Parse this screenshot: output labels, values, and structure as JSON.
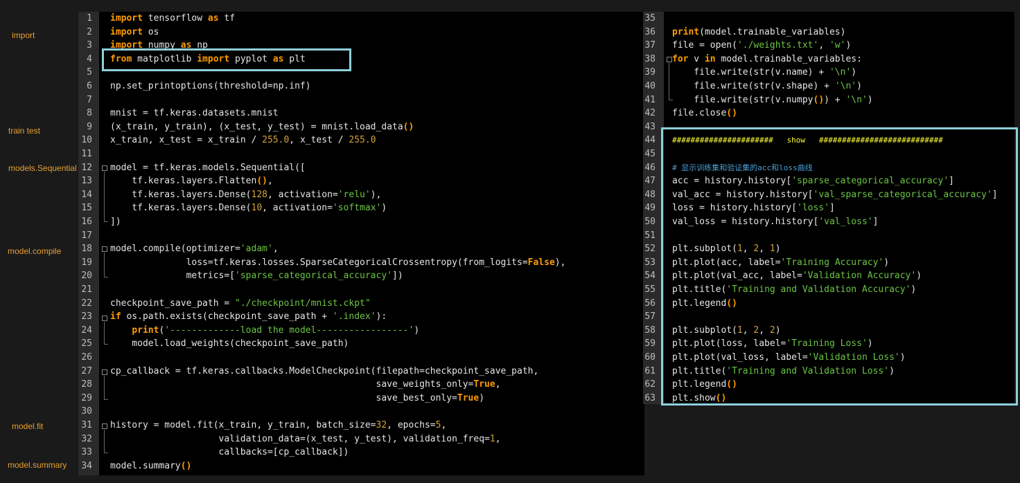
{
  "side_labels": [
    {
      "id": "import",
      "text": "import"
    },
    {
      "id": "train-test",
      "text": "train  test"
    },
    {
      "id": "models-sequential",
      "text": "models.Sequential"
    },
    {
      "id": "model-compile",
      "text": "model.compile"
    },
    {
      "id": "model-fit",
      "text": "model.fit"
    },
    {
      "id": "model-summary",
      "text": "model.summary"
    }
  ],
  "left_panel": {
    "lines": [
      {
        "n": "1",
        "code": "<span class='kw'>import</span> tensorflow <span class='kw'>as</span> tf"
      },
      {
        "n": "2",
        "code": "<span class='kw'>import</span> os"
      },
      {
        "n": "3",
        "code": "<span class='kw'>import</span> numpy <span class='kw'>as</span> np"
      },
      {
        "n": "4",
        "code": "<span class='kw'>from</span> matplotlib <span class='kw'>import</span> pyplot <span class='kw'>as</span> plt"
      },
      {
        "n": "5",
        "code": ""
      },
      {
        "n": "6",
        "code": "np.set_printoptions(threshold=np.inf)"
      },
      {
        "n": "7",
        "code": ""
      },
      {
        "n": "8",
        "code": "mnist = tf.keras.datasets.mnist"
      },
      {
        "n": "9",
        "code": "(x_train, y_train), (x_test, y_test) = mnist.load_data<span class='kw'>()</span>"
      },
      {
        "n": "10",
        "code": "x_train, x_test = x_train / <span class='nm'>255.0</span>, x_test / <span class='nm'>255.0</span>"
      },
      {
        "n": "11",
        "code": ""
      },
      {
        "n": "12",
        "code": "model = tf.keras.models.Sequential(["
      },
      {
        "n": "13",
        "code": "    tf.keras.layers.Flatten<span class='kw'>()</span>,"
      },
      {
        "n": "14",
        "code": "    tf.keras.layers.Dense(<span class='nm'>128</span>, activation=<span class='st'>'relu'</span>),"
      },
      {
        "n": "15",
        "code": "    tf.keras.layers.Dense(<span class='nm'>10</span>, activation=<span class='st'>'softmax'</span>)"
      },
      {
        "n": "16",
        "code": "])"
      },
      {
        "n": "17",
        "code": ""
      },
      {
        "n": "18",
        "code": "model.compile(optimizer=<span class='st'>'adam'</span>,"
      },
      {
        "n": "19",
        "code": "              loss=tf.keras.losses.SparseCategoricalCrossentropy(from_logits=<span class='kw'>False</span>),"
      },
      {
        "n": "20",
        "code": "              metrics=[<span class='st'>'sparse_categorical_accuracy'</span>])"
      },
      {
        "n": "21",
        "code": ""
      },
      {
        "n": "22",
        "code": "checkpoint_save_path = <span class='st'>\"./checkpoint/mnist.ckpt\"</span>"
      },
      {
        "n": "23",
        "code": "<span class='kw'>if</span> os.path.exists(checkpoint_save_path + <span class='st'>'.index'</span>):"
      },
      {
        "n": "24",
        "code": "    <span class='kw'>print</span>(<span class='st'>'-------------load the model-----------------'</span>)"
      },
      {
        "n": "25",
        "code": "    model.load_weights(checkpoint_save_path)"
      },
      {
        "n": "26",
        "code": ""
      },
      {
        "n": "27",
        "code": "cp_callback = tf.keras.callbacks.ModelCheckpoint(filepath=checkpoint_save_path,"
      },
      {
        "n": "28",
        "code": "                                                 save_weights_only=<span class='kw'>True</span>,"
      },
      {
        "n": "29",
        "code": "                                                 save_best_only=<span class='kw'>True</span>)"
      },
      {
        "n": "30",
        "code": ""
      },
      {
        "n": "31",
        "code": "history = model.fit(x_train, y_train, batch_size=<span class='nm'>32</span>, epochs=<span class='nm'>5</span>,"
      },
      {
        "n": "32",
        "code": "                    validation_data=(x_test, y_test), validation_freq=<span class='nm'>1</span>,"
      },
      {
        "n": "33",
        "code": "                    callbacks=[cp_callback])"
      },
      {
        "n": "34",
        "code": "model.summary<span class='kw'>()</span>"
      }
    ]
  },
  "right_panel": {
    "lines": [
      {
        "n": "35",
        "code": ""
      },
      {
        "n": "36",
        "code": "<span class='kw'>print</span>(model.trainable_variables)"
      },
      {
        "n": "37",
        "code": "file = open(<span class='st'>'./weights.txt'</span>, <span class='st'>'w'</span>)"
      },
      {
        "n": "38",
        "code": "<span class='kw'>for</span> v <span class='kw'>in</span> model.trainable_variables:"
      },
      {
        "n": "39",
        "code": "    file.write(str(v.name) + <span class='st'>'\\n'</span>)"
      },
      {
        "n": "40",
        "code": "    file.write(str(v.shape) + <span class='st'>'\\n'</span>)"
      },
      {
        "n": "41",
        "code": "    file.write(str(v.numpy<span class='kw'>()</span>) + <span class='st'>'\\n'</span>)"
      },
      {
        "n": "42",
        "code": "file.close<span class='kw'>()</span>"
      },
      {
        "n": "43",
        "code": ""
      },
      {
        "n": "44",
        "code": "<span class='hash' style='font-size:11px'>######################   show   ###########################</span>"
      },
      {
        "n": "45",
        "code": ""
      },
      {
        "n": "46",
        "code": "<span class='cm' style='font-size:11px'># 显示训练集和验证集的acc和loss曲线</span>"
      },
      {
        "n": "47",
        "code": "acc = history.history[<span class='st'>'sparse_categorical_accuracy'</span>]"
      },
      {
        "n": "48",
        "code": "val_acc = history.history[<span class='st'>'val_sparse_categorical_accuracy'</span>]"
      },
      {
        "n": "49",
        "code": "loss = history.history[<span class='st'>'loss'</span>]"
      },
      {
        "n": "50",
        "code": "val_loss = history.history[<span class='st'>'val_loss'</span>]"
      },
      {
        "n": "51",
        "code": ""
      },
      {
        "n": "52",
        "code": "plt.subplot(<span class='nm'>1</span>, <span class='nm'>2</span>, <span class='nm'>1</span>)"
      },
      {
        "n": "53",
        "code": "plt.plot(acc, label=<span class='st'>'Training Accuracy'</span>)"
      },
      {
        "n": "54",
        "code": "plt.plot(val_acc, label=<span class='st'>'Validation Accuracy'</span>)"
      },
      {
        "n": "55",
        "code": "plt.title(<span class='st'>'Training and Validation Accuracy'</span>)"
      },
      {
        "n": "56",
        "code": "plt.legend<span class='kw'>()</span>"
      },
      {
        "n": "57",
        "code": ""
      },
      {
        "n": "58",
        "code": "plt.subplot(<span class='nm'>1</span>, <span class='nm'>2</span>, <span class='nm'>2</span>)"
      },
      {
        "n": "59",
        "code": "plt.plot(loss, label=<span class='st'>'Training Loss'</span>)"
      },
      {
        "n": "60",
        "code": "plt.plot(val_loss, label=<span class='st'>'Validation Loss'</span>)"
      },
      {
        "n": "61",
        "code": "plt.title(<span class='st'>'Training and Validation Loss'</span>)"
      },
      {
        "n": "62",
        "code": "plt.legend<span class='kw'>()</span>"
      },
      {
        "n": "63",
        "code": "plt.show<span class='kw'>()</span>"
      }
    ]
  }
}
